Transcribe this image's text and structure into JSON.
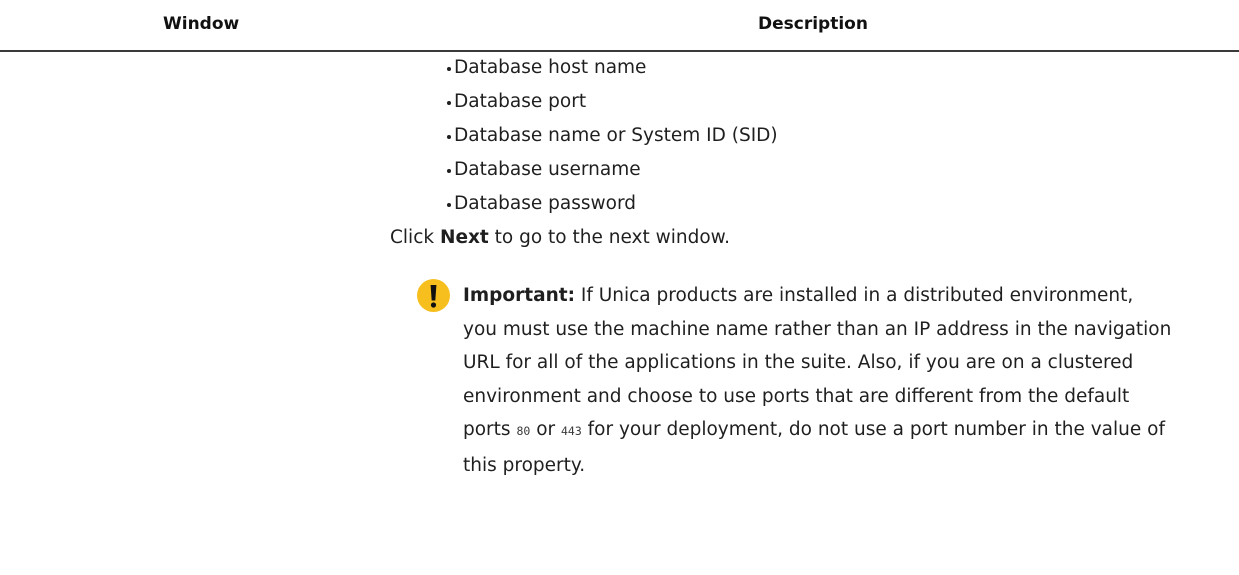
{
  "table": {
    "headers": {
      "window": "Window",
      "description": "Description"
    }
  },
  "description": {
    "bullets": [
      "Database host name",
      "Database port",
      "Database name or System ID (SID)",
      "Database username",
      "Database password"
    ],
    "instruction": {
      "pre": "Click ",
      "bold": "Next",
      "post": " to go to the next window."
    },
    "note": {
      "icon": "exclamation-icon",
      "icon_color": "#f6bf1e",
      "label": "Important:",
      "text_1": " If Unica products are installed in a distributed environment, you must use the machine name rather than an IP address in the navigation URL for all of the applications in the suite. Also, if you are on a clustered environment and choose to use ports that are different from the default ports ",
      "port_1": "80",
      "text_2": " or ",
      "port_2": "443",
      "text_3": " for your deployment, do not use a port number in the value of this property."
    }
  }
}
